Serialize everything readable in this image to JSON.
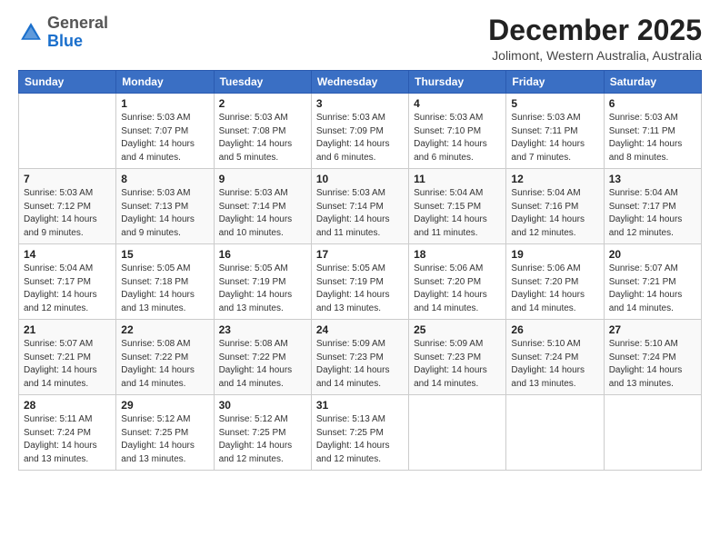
{
  "logo": {
    "general": "General",
    "blue": "Blue"
  },
  "header": {
    "title": "December 2025",
    "subtitle": "Jolimont, Western Australia, Australia"
  },
  "weekdays": [
    "Sunday",
    "Monday",
    "Tuesday",
    "Wednesday",
    "Thursday",
    "Friday",
    "Saturday"
  ],
  "weeks": [
    [
      {
        "day": "",
        "sunrise": "",
        "sunset": "",
        "daylight": ""
      },
      {
        "day": "1",
        "sunrise": "Sunrise: 5:03 AM",
        "sunset": "Sunset: 7:07 PM",
        "daylight": "Daylight: 14 hours and 4 minutes."
      },
      {
        "day": "2",
        "sunrise": "Sunrise: 5:03 AM",
        "sunset": "Sunset: 7:08 PM",
        "daylight": "Daylight: 14 hours and 5 minutes."
      },
      {
        "day": "3",
        "sunrise": "Sunrise: 5:03 AM",
        "sunset": "Sunset: 7:09 PM",
        "daylight": "Daylight: 14 hours and 6 minutes."
      },
      {
        "day": "4",
        "sunrise": "Sunrise: 5:03 AM",
        "sunset": "Sunset: 7:10 PM",
        "daylight": "Daylight: 14 hours and 6 minutes."
      },
      {
        "day": "5",
        "sunrise": "Sunrise: 5:03 AM",
        "sunset": "Sunset: 7:11 PM",
        "daylight": "Daylight: 14 hours and 7 minutes."
      },
      {
        "day": "6",
        "sunrise": "Sunrise: 5:03 AM",
        "sunset": "Sunset: 7:11 PM",
        "daylight": "Daylight: 14 hours and 8 minutes."
      }
    ],
    [
      {
        "day": "7",
        "sunrise": "Sunrise: 5:03 AM",
        "sunset": "Sunset: 7:12 PM",
        "daylight": "Daylight: 14 hours and 9 minutes."
      },
      {
        "day": "8",
        "sunrise": "Sunrise: 5:03 AM",
        "sunset": "Sunset: 7:13 PM",
        "daylight": "Daylight: 14 hours and 9 minutes."
      },
      {
        "day": "9",
        "sunrise": "Sunrise: 5:03 AM",
        "sunset": "Sunset: 7:14 PM",
        "daylight": "Daylight: 14 hours and 10 minutes."
      },
      {
        "day": "10",
        "sunrise": "Sunrise: 5:03 AM",
        "sunset": "Sunset: 7:14 PM",
        "daylight": "Daylight: 14 hours and 11 minutes."
      },
      {
        "day": "11",
        "sunrise": "Sunrise: 5:04 AM",
        "sunset": "Sunset: 7:15 PM",
        "daylight": "Daylight: 14 hours and 11 minutes."
      },
      {
        "day": "12",
        "sunrise": "Sunrise: 5:04 AM",
        "sunset": "Sunset: 7:16 PM",
        "daylight": "Daylight: 14 hours and 12 minutes."
      },
      {
        "day": "13",
        "sunrise": "Sunrise: 5:04 AM",
        "sunset": "Sunset: 7:17 PM",
        "daylight": "Daylight: 14 hours and 12 minutes."
      }
    ],
    [
      {
        "day": "14",
        "sunrise": "Sunrise: 5:04 AM",
        "sunset": "Sunset: 7:17 PM",
        "daylight": "Daylight: 14 hours and 12 minutes."
      },
      {
        "day": "15",
        "sunrise": "Sunrise: 5:05 AM",
        "sunset": "Sunset: 7:18 PM",
        "daylight": "Daylight: 14 hours and 13 minutes."
      },
      {
        "day": "16",
        "sunrise": "Sunrise: 5:05 AM",
        "sunset": "Sunset: 7:19 PM",
        "daylight": "Daylight: 14 hours and 13 minutes."
      },
      {
        "day": "17",
        "sunrise": "Sunrise: 5:05 AM",
        "sunset": "Sunset: 7:19 PM",
        "daylight": "Daylight: 14 hours and 13 minutes."
      },
      {
        "day": "18",
        "sunrise": "Sunrise: 5:06 AM",
        "sunset": "Sunset: 7:20 PM",
        "daylight": "Daylight: 14 hours and 14 minutes."
      },
      {
        "day": "19",
        "sunrise": "Sunrise: 5:06 AM",
        "sunset": "Sunset: 7:20 PM",
        "daylight": "Daylight: 14 hours and 14 minutes."
      },
      {
        "day": "20",
        "sunrise": "Sunrise: 5:07 AM",
        "sunset": "Sunset: 7:21 PM",
        "daylight": "Daylight: 14 hours and 14 minutes."
      }
    ],
    [
      {
        "day": "21",
        "sunrise": "Sunrise: 5:07 AM",
        "sunset": "Sunset: 7:21 PM",
        "daylight": "Daylight: 14 hours and 14 minutes."
      },
      {
        "day": "22",
        "sunrise": "Sunrise: 5:08 AM",
        "sunset": "Sunset: 7:22 PM",
        "daylight": "Daylight: 14 hours and 14 minutes."
      },
      {
        "day": "23",
        "sunrise": "Sunrise: 5:08 AM",
        "sunset": "Sunset: 7:22 PM",
        "daylight": "Daylight: 14 hours and 14 minutes."
      },
      {
        "day": "24",
        "sunrise": "Sunrise: 5:09 AM",
        "sunset": "Sunset: 7:23 PM",
        "daylight": "Daylight: 14 hours and 14 minutes."
      },
      {
        "day": "25",
        "sunrise": "Sunrise: 5:09 AM",
        "sunset": "Sunset: 7:23 PM",
        "daylight": "Daylight: 14 hours and 14 minutes."
      },
      {
        "day": "26",
        "sunrise": "Sunrise: 5:10 AM",
        "sunset": "Sunset: 7:24 PM",
        "daylight": "Daylight: 14 hours and 13 minutes."
      },
      {
        "day": "27",
        "sunrise": "Sunrise: 5:10 AM",
        "sunset": "Sunset: 7:24 PM",
        "daylight": "Daylight: 14 hours and 13 minutes."
      }
    ],
    [
      {
        "day": "28",
        "sunrise": "Sunrise: 5:11 AM",
        "sunset": "Sunset: 7:24 PM",
        "daylight": "Daylight: 14 hours and 13 minutes."
      },
      {
        "day": "29",
        "sunrise": "Sunrise: 5:12 AM",
        "sunset": "Sunset: 7:25 PM",
        "daylight": "Daylight: 14 hours and 13 minutes."
      },
      {
        "day": "30",
        "sunrise": "Sunrise: 5:12 AM",
        "sunset": "Sunset: 7:25 PM",
        "daylight": "Daylight: 14 hours and 12 minutes."
      },
      {
        "day": "31",
        "sunrise": "Sunrise: 5:13 AM",
        "sunset": "Sunset: 7:25 PM",
        "daylight": "Daylight: 14 hours and 12 minutes."
      },
      {
        "day": "",
        "sunrise": "",
        "sunset": "",
        "daylight": ""
      },
      {
        "day": "",
        "sunrise": "",
        "sunset": "",
        "daylight": ""
      },
      {
        "day": "",
        "sunrise": "",
        "sunset": "",
        "daylight": ""
      }
    ]
  ]
}
